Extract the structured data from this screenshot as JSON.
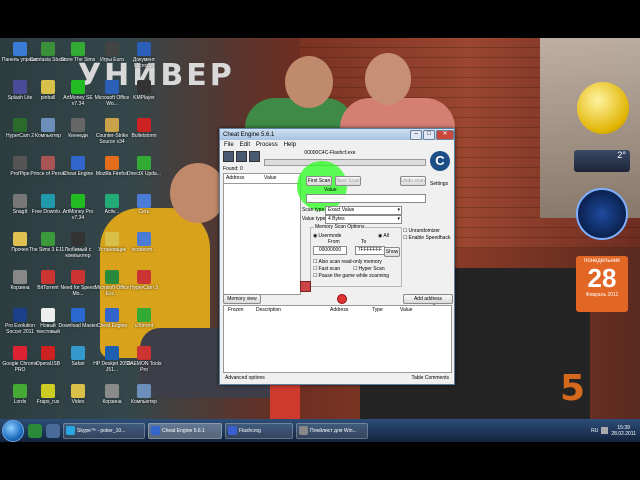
{
  "brand": {
    "text": "УНИВЕР",
    "logo": "5"
  },
  "desktop_icons": [
    {
      "label": "Панель управл.",
      "color": "#3a7bd5",
      "icon": "control-panel-icon"
    },
    {
      "label": "Splash Lite",
      "color": "#4a4a9a",
      "icon": "splash-icon"
    },
    {
      "label": "HyperCam 2",
      "color": "#2b6a2b",
      "icon": "hypercam-icon"
    },
    {
      "label": "ProfPipe",
      "color": "#555",
      "icon": "app-icon"
    },
    {
      "label": "SnagIt",
      "color": "#777",
      "icon": "app-icon"
    },
    {
      "label": "Прочее",
      "color": "#e0c050",
      "icon": "folder-icon"
    },
    {
      "label": "Корзина",
      "color": "#888",
      "icon": "recycle-bin-icon"
    },
    {
      "label": "Pro Evolution Soccer 2011",
      "color": "#1c3f8a",
      "icon": "game-icon"
    },
    {
      "label": "Google Chrome PRO",
      "color": "#d23",
      "icon": "chrome-icon"
    },
    {
      "label": "Lords",
      "color": "#4a3",
      "icon": "app-icon"
    },
    {
      "label": "Camtasia Studio",
      "color": "#3a8f3a",
      "icon": "camtasia-icon"
    },
    {
      "label": "pinball",
      "color": "#d8c04a",
      "icon": "folder-icon"
    },
    {
      "label": "Компьютер",
      "color": "#6b8fb8",
      "icon": "computer-icon"
    },
    {
      "label": "Prince of Persia",
      "color": "#a55",
      "icon": "game-icon"
    },
    {
      "label": "Free Downlo...",
      "color": "#29a",
      "icon": "download-icon"
    },
    {
      "label": "The Sims 3 Е117",
      "color": "#3b9b3b",
      "icon": "game-icon"
    },
    {
      "label": "BitTorrent",
      "color": "#c33",
      "icon": "torrent-icon"
    },
    {
      "label": "Новый текстовый",
      "color": "#eee",
      "icon": "text-file-icon"
    },
    {
      "label": "OperaUSB",
      "color": "#c22",
      "icon": "opera-icon"
    },
    {
      "label": "Fraps_rus",
      "color": "#cc2",
      "icon": "fraps-icon"
    },
    {
      "label": "Store The Sims",
      "color": "#3a3",
      "icon": "game-icon"
    },
    {
      "label": "ArtMoney SE v7.34",
      "color": "#2b2",
      "icon": "artmoney-icon"
    },
    {
      "label": "Кеннеди",
      "color": "#666",
      "icon": "app-icon"
    },
    {
      "label": "Cheat Engine",
      "color": "#36c",
      "icon": "cheat-engine-icon"
    },
    {
      "label": "ArtMoney Pro v7.34",
      "color": "#2b2",
      "icon": "artmoney-icon"
    },
    {
      "label": "Любимый с компьютер",
      "color": "#333",
      "icon": "app-icon"
    },
    {
      "label": "Need for Speed Mo...",
      "color": "#c33",
      "icon": "game-icon"
    },
    {
      "label": "Download Master",
      "color": "#2a6ad0",
      "icon": "download-icon"
    },
    {
      "label": "Safari",
      "color": "#39c",
      "icon": "safari-icon"
    },
    {
      "label": "Video",
      "color": "#d8c04a",
      "icon": "folder-icon"
    },
    {
      "label": "Игры Euro",
      "color": "#444",
      "icon": "game-icon"
    },
    {
      "label": "Microsoft Office Wo...",
      "color": "#2b5fb8",
      "icon": "word-icon"
    },
    {
      "label": "Counter-Strike Source v34",
      "color": "#caa24a",
      "icon": "game-icon"
    },
    {
      "label": "Mozilla Firefox",
      "color": "#e46e1b",
      "icon": "firefox-icon"
    },
    {
      "label": "Activ...",
      "color": "#2a7",
      "icon": "app-icon"
    },
    {
      "label": "Установщик",
      "color": "#d8c04a",
      "icon": "folder-icon"
    },
    {
      "label": "Microsoft Office Exc...",
      "color": "#2a8a3a",
      "icon": "excel-icon"
    },
    {
      "label": "Cheat Engine",
      "color": "#36c",
      "icon": "cheat-engine-icon"
    },
    {
      "label": "HP Deskjet 2050 J51...",
      "color": "#1e5fb0",
      "icon": "printer-icon"
    },
    {
      "label": "Корзина",
      "color": "#8a8a8a",
      "icon": "recycle-bin-icon"
    },
    {
      "label": "Документ Microsoft",
      "color": "#2b5fb8",
      "icon": "word-icon"
    },
    {
      "label": "KMPlayer",
      "color": "#333",
      "icon": "kmplayer-icon"
    },
    {
      "label": "Bulletstorm",
      "color": "#c22",
      "icon": "game-icon"
    },
    {
      "label": "DirectX Upda...",
      "color": "#3a3",
      "icon": "app-icon"
    },
    {
      "label": "Сеть",
      "color": "#4a7bd5",
      "icon": "network-icon"
    },
    {
      "label": "ocodeem...",
      "color": "#4a7bd5",
      "icon": "app-icon"
    },
    {
      "label": "HyperCam 3",
      "color": "#c33",
      "icon": "hypercam-icon"
    },
    {
      "label": "uTorrent",
      "color": "#3a3",
      "icon": "utorrent-icon"
    },
    {
      "label": "DAEMON Tools Pro",
      "color": "#c33",
      "icon": "daemon-icon"
    },
    {
      "label": "Компьютер",
      "color": "#6b8fb8",
      "icon": "computer-icon"
    }
  ],
  "gadgets": {
    "cpu_value": "2°",
    "calendar": {
      "dow": "понедельник",
      "day": "28",
      "month": "Февраль 2011"
    }
  },
  "cheat_engine": {
    "title": "Cheat Engine 5.6.1",
    "menu": [
      "File",
      "Edit",
      "Process",
      "Help"
    ],
    "process_title": "00000C4C-Flashcf.exe",
    "found_label": "Found: 0",
    "list_headers": [
      "Address",
      "Value"
    ],
    "buttons": {
      "first_scan": "First Scan",
      "next_scan": "Next Scan",
      "undo_scan": "Undo scan",
      "show": "Show",
      "memory_view": "Memory view",
      "add_address": "Add address manually"
    },
    "settings_label": "Settings",
    "value_label": "Value:",
    "scan_type_label": "Scan type",
    "scan_type_value": "Exact Value",
    "value_type_label": "Value type",
    "value_type_value": "4 Bytes",
    "memory_group_title": "Memory Scan Options",
    "usermode_label": "Usermode",
    "all_label": "All",
    "from_label": "From",
    "to_label": "To",
    "from_value": "00000000",
    "to_value": "7FFFFFFF",
    "also_scan_readonly": "Also scan read-only memory",
    "fast_scan": "Fast scan",
    "hyper_scan": "Hyper Scan",
    "pause_game": "Pause the game while scanning",
    "unrandomizer": "Unrandomizer",
    "enable_speedhack": "Enable Speedhack",
    "address_table_headers": [
      "Frozen",
      "Description",
      "Address",
      "Type",
      "Value"
    ],
    "advanced_options": "Advanced options",
    "table_comments": "Table Comments"
  },
  "taskbar": {
    "tasks": [
      {
        "label": "Skype™ - poker_10...",
        "color": "#2aa7e0",
        "icon": "skype-icon",
        "active": false
      },
      {
        "label": "Cheat Engine 5.6.1",
        "color": "#36c",
        "icon": "cheat-engine-icon",
        "active": true
      },
      {
        "label": "Flashcrog",
        "color": "#3a5fd0",
        "icon": "flash-icon",
        "active": false
      },
      {
        "label": "Плейлист для Win...",
        "color": "#888",
        "icon": "media-player-icon",
        "active": false
      }
    ],
    "tray_lang": "RU",
    "time": "15:39",
    "date": "28.02.2011"
  }
}
